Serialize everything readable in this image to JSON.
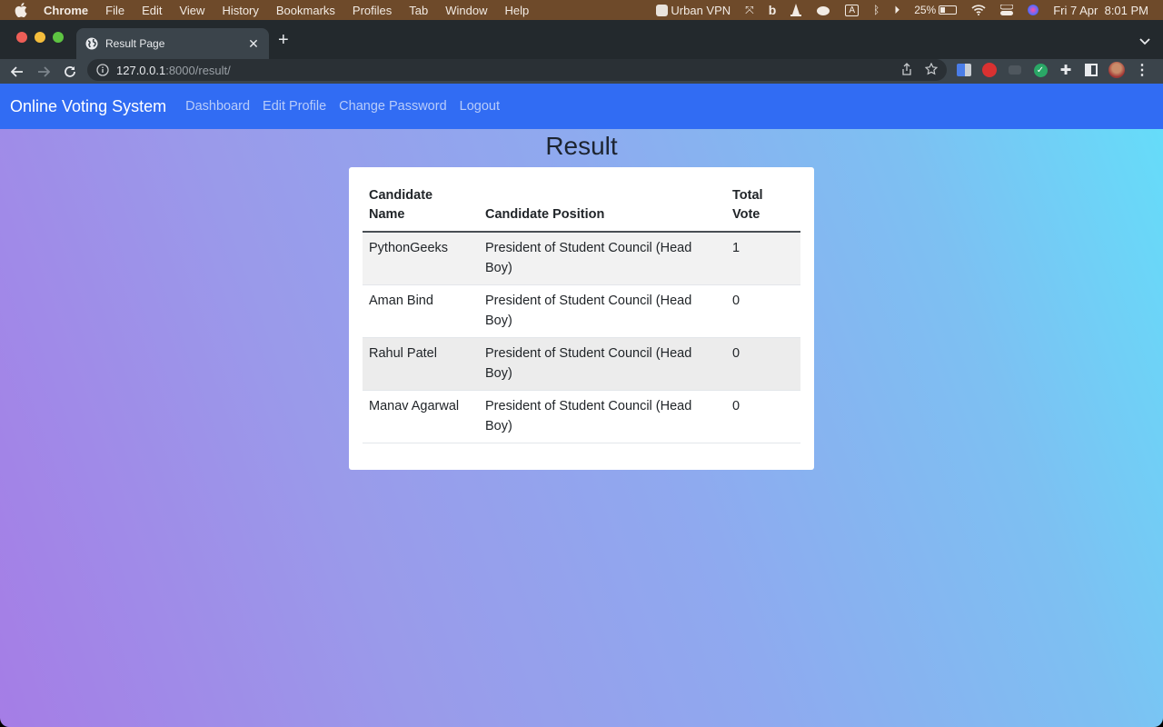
{
  "menubar": {
    "app": "Chrome",
    "items": [
      "File",
      "Edit",
      "View",
      "History",
      "Bookmarks",
      "Profiles",
      "Tab",
      "Window",
      "Help"
    ],
    "status": {
      "vpn_label": "Urban VPN",
      "battery": "25%",
      "datetime": "Fri 7 Apr  8:01 PM"
    }
  },
  "browser": {
    "tab_title": "Result Page",
    "url_host": "127.0.0.1",
    "url_path": ":8000/result/"
  },
  "navbar": {
    "brand": "Online Voting System",
    "links": [
      "Dashboard",
      "Edit Profile",
      "Change Password",
      "Logout"
    ]
  },
  "main": {
    "title": "Result",
    "table": {
      "headers": [
        "Candidate Name",
        "Candidate Position",
        "Total Vote"
      ],
      "rows": [
        {
          "name": "PythonGeeks",
          "position": "President of Student Council (Head Boy)",
          "votes": "1"
        },
        {
          "name": "Aman Bind",
          "position": "President of Student Council (Head Boy)",
          "votes": "0"
        },
        {
          "name": "Rahul Patel",
          "position": "President of Student Council (Head Boy)",
          "votes": "0"
        },
        {
          "name": "Manav Agarwal",
          "position": "President of Student Council (Head Boy)",
          "votes": "0"
        }
      ]
    }
  },
  "colors": {
    "navbar": "#316cf3",
    "gradient_left": "#a57de6",
    "gradient_right": "#64defa"
  }
}
